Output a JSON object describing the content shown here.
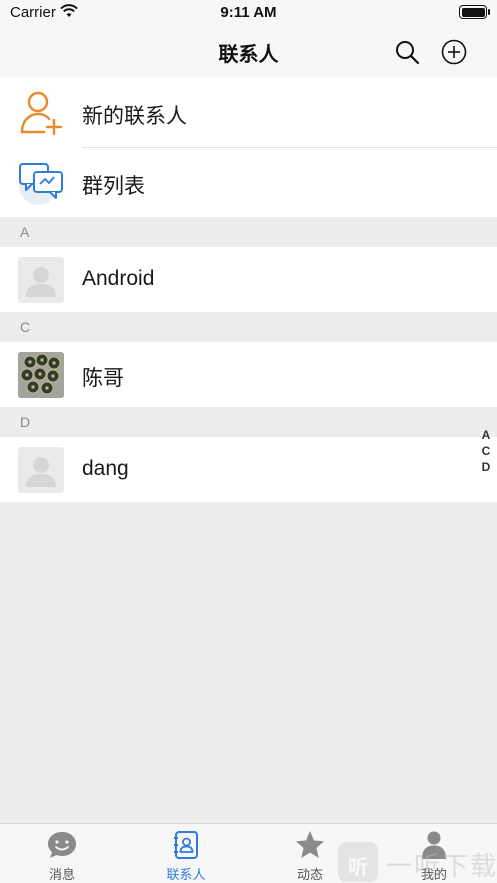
{
  "status_bar": {
    "carrier": "Carrier",
    "time": "9:11 AM",
    "battery_level": 1.0
  },
  "nav": {
    "title": "联系人",
    "search_icon": "search-icon",
    "add_icon": "plus-circle-icon"
  },
  "top_items": [
    {
      "label": "新的联系人",
      "icon": "add-user-icon",
      "icon_color": "#e98a2e"
    },
    {
      "label": "群列表",
      "icon": "group-chat-icon",
      "icon_color": "#2f7bde"
    }
  ],
  "sections": [
    {
      "letter": "A",
      "contacts": [
        {
          "name": "Android",
          "avatar": "default-avatar"
        }
      ]
    },
    {
      "letter": "C",
      "contacts": [
        {
          "name": "陈哥",
          "avatar": "coins-photo"
        }
      ]
    },
    {
      "letter": "D",
      "contacts": [
        {
          "name": "dang",
          "avatar": "default-avatar"
        }
      ]
    }
  ],
  "index_letters": [
    "A",
    "C",
    "D"
  ],
  "tabs": [
    {
      "label": "消息",
      "icon": "chat-bubble-icon",
      "active": false
    },
    {
      "label": "联系人",
      "icon": "contacts-book-icon",
      "active": true
    },
    {
      "label": "动态",
      "icon": "star-icon",
      "active": false
    },
    {
      "label": "我的",
      "icon": "person-icon",
      "active": false
    }
  ],
  "watermark": {
    "glyph": "听",
    "text": "一听下载"
  },
  "colors": {
    "accent": "#2f7bde",
    "orange": "#e98a2e",
    "background": "#ededed"
  }
}
